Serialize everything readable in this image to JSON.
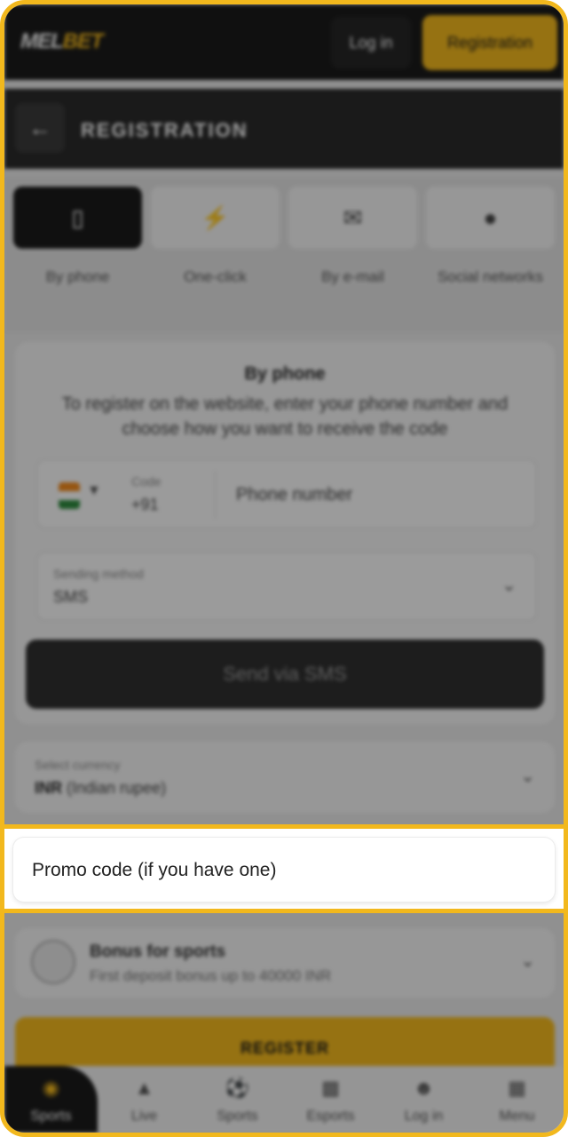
{
  "header": {
    "logo_a": "MEL",
    "logo_b": "BET",
    "login_label": "Log in",
    "register_label": "Registration",
    "brand_color": "#f2b81d"
  },
  "subheader": {
    "back_icon": "arrow-left-icon",
    "title": "REGISTRATION"
  },
  "tabs": [
    {
      "icon": "phone-icon",
      "label": "By phone",
      "active": true
    },
    {
      "icon": "lightning-icon",
      "label": "One-click",
      "active": false
    },
    {
      "icon": "mail-icon",
      "label": "By e-mail",
      "active": false
    },
    {
      "icon": "social-icon",
      "label": "Social networks",
      "active": false
    }
  ],
  "form": {
    "title": "By phone",
    "description": "To register on the website, enter your phone number and choose how you want to receive the code",
    "code_label": "Code",
    "code_value": "+91",
    "phone_placeholder": "Phone number",
    "method_label": "Sending method",
    "method_value": "SMS",
    "send_label": "Send via SMS"
  },
  "currency": {
    "label": "Select currency",
    "value_code": "INR",
    "value_name": "(Indian rupee)"
  },
  "promo": {
    "placeholder": "Promo code (if you have one)"
  },
  "bonus": {
    "title": "Bonus for sports",
    "subtitle": "First deposit bonus up to 40000 INR"
  },
  "register_button": "REGISTER",
  "bottom_nav": [
    {
      "icon": "sports-icon",
      "label": "Sports",
      "active": true
    },
    {
      "icon": "fire-icon",
      "label": "Live",
      "active": false
    },
    {
      "icon": "ball-icon",
      "label": "Sports",
      "active": false
    },
    {
      "icon": "gamepad-icon",
      "label": "Esports",
      "active": false
    },
    {
      "icon": "user-icon",
      "label": "Log in",
      "active": false
    },
    {
      "icon": "menu-icon",
      "label": "Menu",
      "active": false
    }
  ]
}
